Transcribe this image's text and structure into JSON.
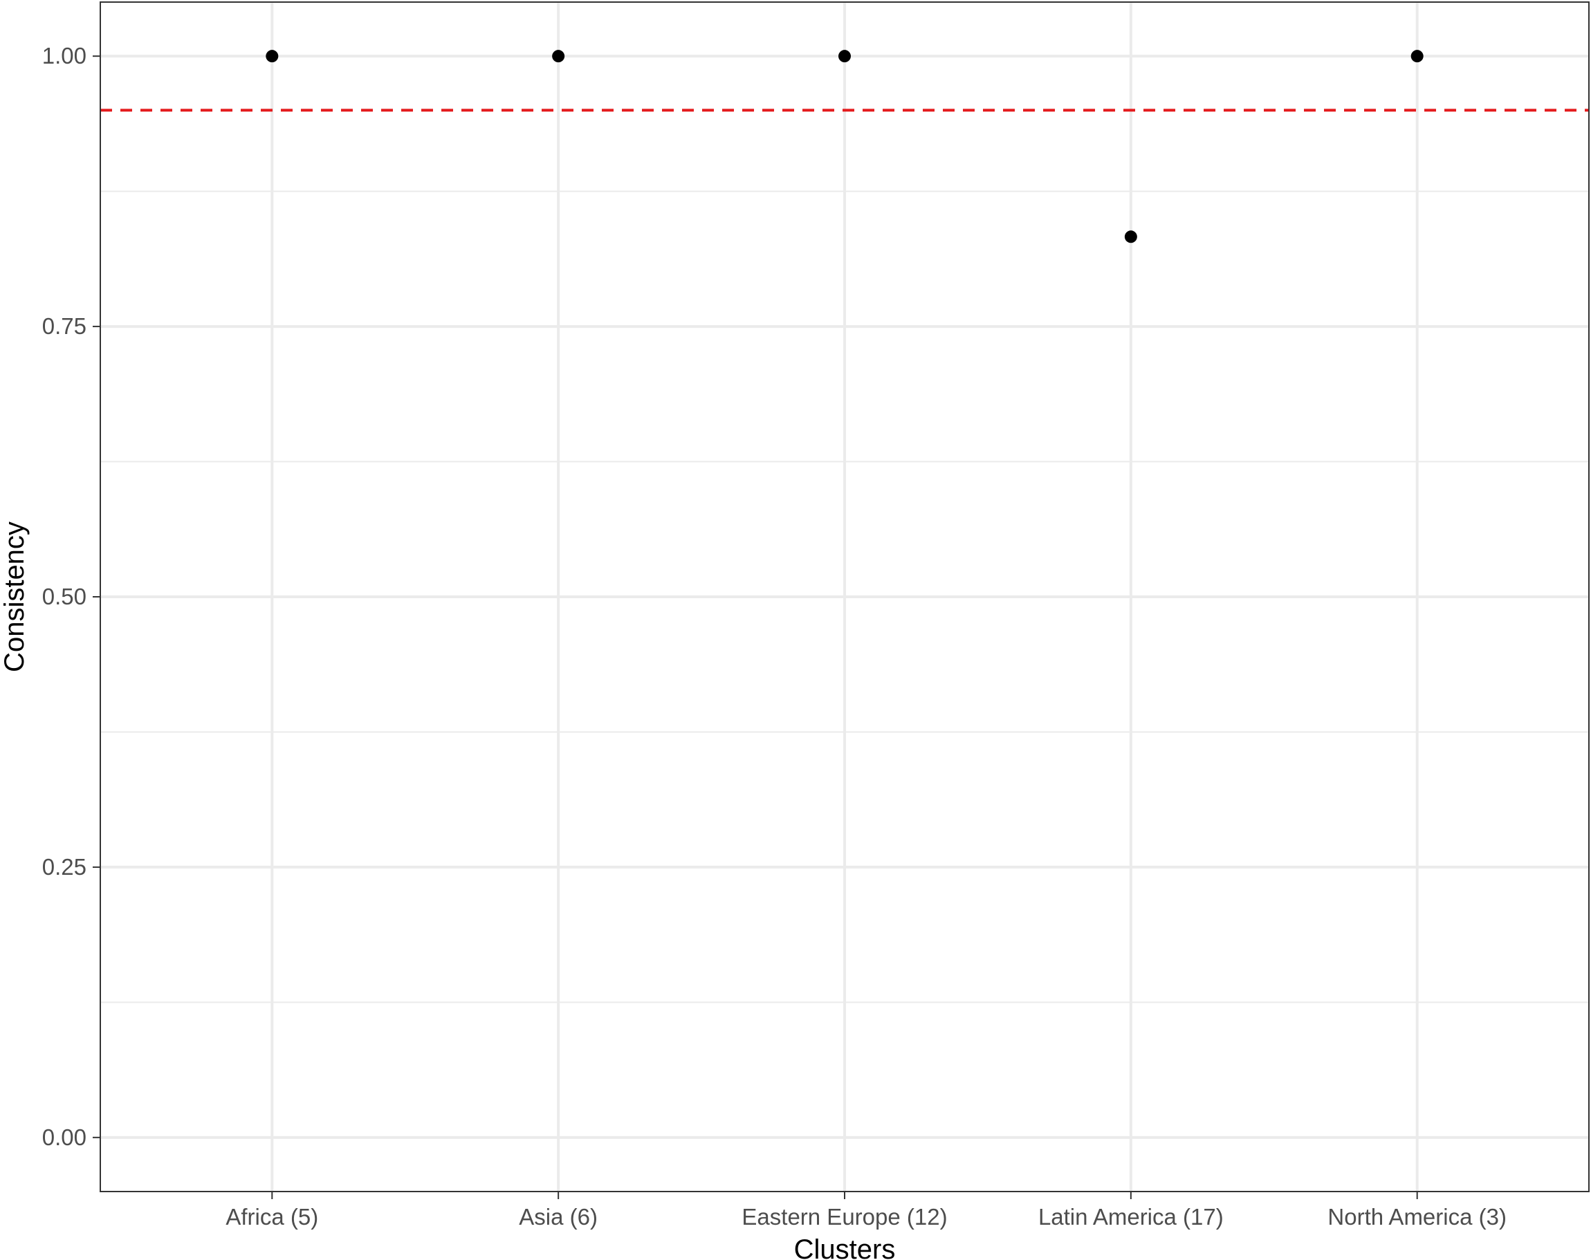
{
  "chart_data": {
    "type": "scatter",
    "title": "",
    "xlabel": "Clusters",
    "ylabel": "Consistency",
    "categories": [
      "Africa (5)",
      "Asia (6)",
      "Eastern Europe (12)",
      "Latin America (17)",
      "North America (3)"
    ],
    "values": [
      1.0,
      1.0,
      1.0,
      0.833,
      1.0
    ],
    "ylim": [
      -0.05,
      1.05
    ],
    "yticks": [
      0.0,
      0.25,
      0.5,
      0.75,
      1.0
    ],
    "ytick_labels": [
      "0.00",
      "0.25",
      "0.50",
      "0.75",
      "1.00"
    ],
    "reference_line": {
      "y": 0.95,
      "style": "dashed",
      "color": "#e41a1c"
    },
    "grid": true,
    "point_color": "#000000",
    "grid_color": "#ebebeb",
    "panel_border_color": "#333333"
  }
}
